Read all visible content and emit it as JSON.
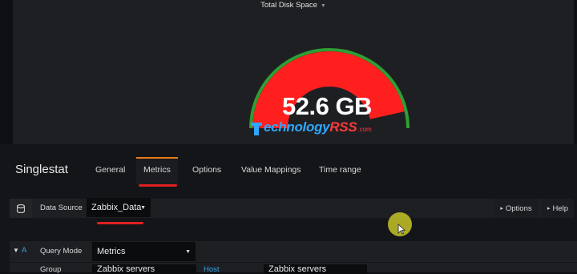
{
  "panel": {
    "title": "Total Disk Space",
    "value_display": "52.6 GB",
    "gauge_fill_fraction": 0.93,
    "colors": {
      "fill": "#ff1f1f",
      "threshold": "#2f9e33",
      "background": "#1e1f23"
    }
  },
  "watermark": {
    "part1": "echnology",
    "part2": "RSS",
    "suffix": ".com"
  },
  "editor": {
    "panel_type": "Singlestat",
    "tabs": [
      "General",
      "Metrics",
      "Options",
      "Value Mappings",
      "Time range"
    ],
    "active_tab": "Metrics"
  },
  "datasource": {
    "label": "Data Source",
    "value": "Zabbix_Data",
    "options_label": "Options",
    "help_label": "Help"
  },
  "query": {
    "ref": "A",
    "mode_label": "Query Mode",
    "mode_value": "Metrics",
    "group_label": "Group",
    "group_value": "Zabbix servers",
    "host_label": "Host",
    "host_value": "Zabbix servers"
  },
  "colors": {
    "accent": "#eb7b18",
    "annotation": "#e02020",
    "link_blue": "#33a2e5"
  }
}
